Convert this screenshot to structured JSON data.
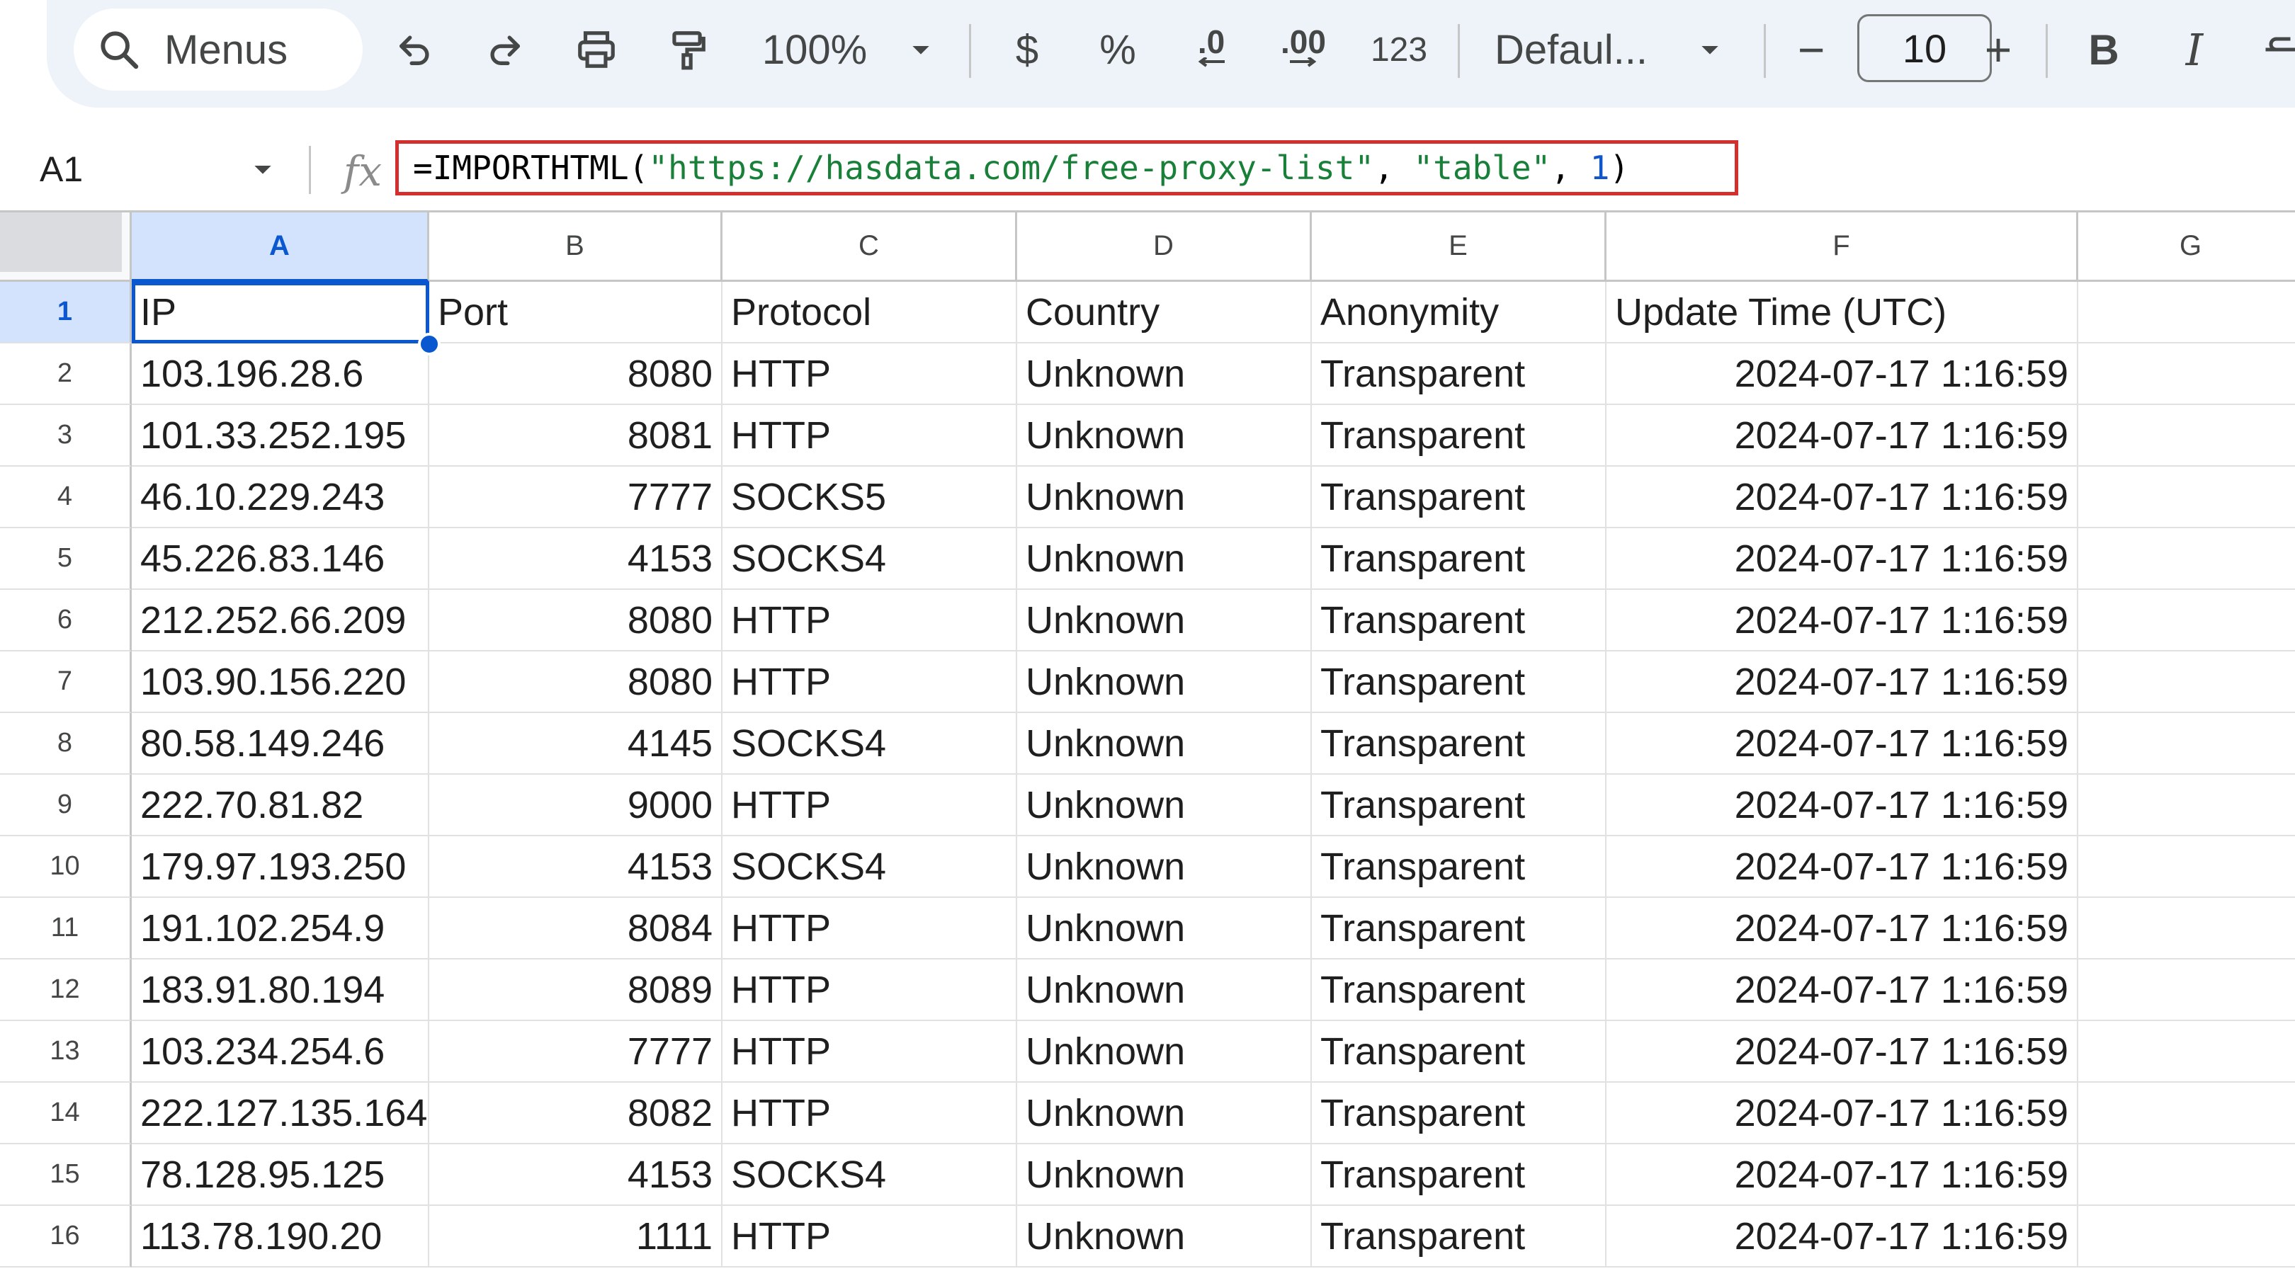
{
  "toolbar": {
    "menus_label": "Menus",
    "zoom_value": "100%",
    "currency_label": "$",
    "percent_label": "%",
    "decrease_decimal_label": ".0",
    "increase_decimal_label": ".00",
    "format_123_label": "123",
    "font_name": "Defaul...",
    "font_size": "10",
    "minus_label": "−",
    "plus_label": "+",
    "bold_label": "B",
    "italic_label": "I"
  },
  "formula_bar": {
    "name_box": "A1",
    "fx_label": "fx",
    "formula": {
      "prefix": "=IMPORTHTML(",
      "url": "\"https://hasdata.com/free-proxy-list\"",
      "sep1": ", ",
      "arg2": "\"table\"",
      "sep2": ", ",
      "arg3": "1",
      "suffix": ")"
    }
  },
  "grid": {
    "columns": [
      "A",
      "B",
      "C",
      "D",
      "E",
      "F",
      "G"
    ],
    "row_numbers": [
      "1",
      "2",
      "3",
      "4",
      "5",
      "6",
      "7",
      "8",
      "9",
      "10",
      "11",
      "12",
      "13",
      "14",
      "15",
      "16"
    ],
    "selected_cell": "A1",
    "header_row": [
      "IP",
      "Port",
      "Protocol",
      "Country",
      "Anonymity",
      "Update Time (UTC)"
    ],
    "rows": [
      [
        "103.196.28.6",
        "8080",
        "HTTP",
        "Unknown",
        "Transparent",
        "2024-07-17 1:16:59"
      ],
      [
        "101.33.252.195",
        "8081",
        "HTTP",
        "Unknown",
        "Transparent",
        "2024-07-17 1:16:59"
      ],
      [
        "46.10.229.243",
        "7777",
        "SOCKS5",
        "Unknown",
        "Transparent",
        "2024-07-17 1:16:59"
      ],
      [
        "45.226.83.146",
        "4153",
        "SOCKS4",
        "Unknown",
        "Transparent",
        "2024-07-17 1:16:59"
      ],
      [
        "212.252.66.209",
        "8080",
        "HTTP",
        "Unknown",
        "Transparent",
        "2024-07-17 1:16:59"
      ],
      [
        "103.90.156.220",
        "8080",
        "HTTP",
        "Unknown",
        "Transparent",
        "2024-07-17 1:16:59"
      ],
      [
        "80.58.149.246",
        "4145",
        "SOCKS4",
        "Unknown",
        "Transparent",
        "2024-07-17 1:16:59"
      ],
      [
        "222.70.81.82",
        "9000",
        "HTTP",
        "Unknown",
        "Transparent",
        "2024-07-17 1:16:59"
      ],
      [
        "179.97.193.250",
        "4153",
        "SOCKS4",
        "Unknown",
        "Transparent",
        "2024-07-17 1:16:59"
      ],
      [
        "191.102.254.9",
        "8084",
        "HTTP",
        "Unknown",
        "Transparent",
        "2024-07-17 1:16:59"
      ],
      [
        "183.91.80.194",
        "8089",
        "HTTP",
        "Unknown",
        "Transparent",
        "2024-07-17 1:16:59"
      ],
      [
        "103.234.254.6",
        "7777",
        "HTTP",
        "Unknown",
        "Transparent",
        "2024-07-17 1:16:59"
      ],
      [
        "222.127.135.164",
        "8082",
        "HTTP",
        "Unknown",
        "Transparent",
        "2024-07-17 1:16:59"
      ],
      [
        "78.128.95.125",
        "4153",
        "SOCKS4",
        "Unknown",
        "Transparent",
        "2024-07-17 1:16:59"
      ],
      [
        "113.78.190.20",
        "1111",
        "HTTP",
        "Unknown",
        "Transparent",
        "2024-07-17 1:16:59"
      ]
    ]
  },
  "colors": {
    "selection": "#0b57d0",
    "selection_fill": "#d3e3fd",
    "formula_highlight_border": "#d32f2f",
    "formula_string": "#188038",
    "formula_number": "#1155cc"
  }
}
